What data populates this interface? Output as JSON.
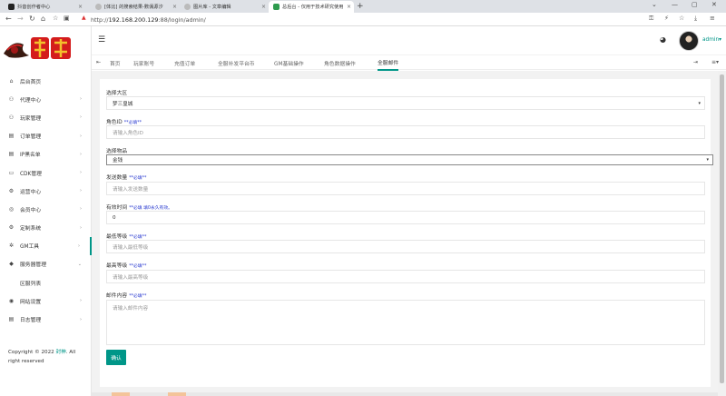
{
  "browser": {
    "tabs": [
      {
        "label": "抖音创作者中心",
        "color": "#222222"
      },
      {
        "label": "[体比] 的搜索结果-數僞源汐",
        "color": "#d84f3a"
      },
      {
        "label": "图片库 - 文章编辑",
        "color": "#7a7a7a"
      },
      {
        "label": "总后台 - 仅用于技术研究使用",
        "color": "#2e9b4e"
      }
    ],
    "url_prefix": "http://",
    "url_host": "192.168.200.129",
    "url_path": ":88/login/admin/"
  },
  "sidebar": {
    "items": [
      {
        "label": "后台首页",
        "icon": "home-icon",
        "glyph": "⌂",
        "chev": ""
      },
      {
        "label": "代理中心",
        "icon": "users-icon",
        "glyph": "⚇",
        "chev": "›"
      },
      {
        "label": "玩家管理",
        "icon": "group-icon",
        "glyph": "⚇",
        "chev": "›"
      },
      {
        "label": "订单管理",
        "icon": "order-icon",
        "glyph": "▤",
        "chev": "›"
      },
      {
        "label": "IP黑名单",
        "icon": "blacklist-icon",
        "glyph": "▤",
        "chev": "›"
      },
      {
        "label": "CDK管理",
        "icon": "cdk-icon",
        "glyph": "▭",
        "chev": "›"
      },
      {
        "label": "运营中心",
        "icon": "settings-icon",
        "glyph": "⚙",
        "chev": "›"
      },
      {
        "label": "会员中心",
        "icon": "member-icon",
        "glyph": "◎",
        "chev": "›"
      },
      {
        "label": "定制系统",
        "icon": "custom-icon",
        "glyph": "⚙",
        "chev": "›"
      },
      {
        "label": "GM工具",
        "icon": "bug-icon",
        "glyph": "✲",
        "chev": "›"
      },
      {
        "label": "服务器管理",
        "icon": "server-icon",
        "glyph": "◆",
        "chev": "⌄"
      },
      {
        "label": "区服列表",
        "icon": "",
        "glyph": "",
        "chev": ""
      },
      {
        "label": "网站设置",
        "icon": "globe-icon",
        "glyph": "◉",
        "chev": "›"
      },
      {
        "label": "日志管理",
        "icon": "log-icon",
        "glyph": "▤",
        "chev": "›"
      }
    ],
    "copyright_prefix": "Copyright © 2022 ",
    "copyright_brand": "封神",
    "copyright_suffix": ". All right reserved"
  },
  "header": {
    "username": "admin",
    "user_caret": "▾"
  },
  "tabsnav": {
    "items": [
      "首页",
      "玩家账号",
      "充值订单",
      "全服补发平台币",
      "GM基础操作",
      "角色数据操作",
      "全服邮件"
    ],
    "active_index": 6
  },
  "form": {
    "zone_label": "选择大区",
    "zone_value": "梦三皇城",
    "role_label": "角色ID",
    "role_required": "**必填**",
    "role_placeholder": "请输入角色ID",
    "item_label": "选择物品",
    "item_value": "金钱",
    "qty_label": "发送数量",
    "qty_required": "**必填**",
    "qty_placeholder": "请输入发送数量",
    "time_label": "有效时间",
    "time_required": "**必填 填0永久有效。",
    "time_value": "0",
    "minlv_label": "最低等级",
    "minlv_required": "**必填**",
    "minlv_placeholder": "请输入最低等级",
    "maxlv_label": "最高等级",
    "maxlv_required": "**必填**",
    "maxlv_placeholder": "请输入最高等级",
    "mail_label": "邮件内容",
    "mail_required": "**必填**",
    "mail_placeholder": "请输入邮件内容",
    "submit_label": "确认"
  },
  "colors": {
    "accent": "#009688",
    "required_note": "#2a3bd0"
  }
}
